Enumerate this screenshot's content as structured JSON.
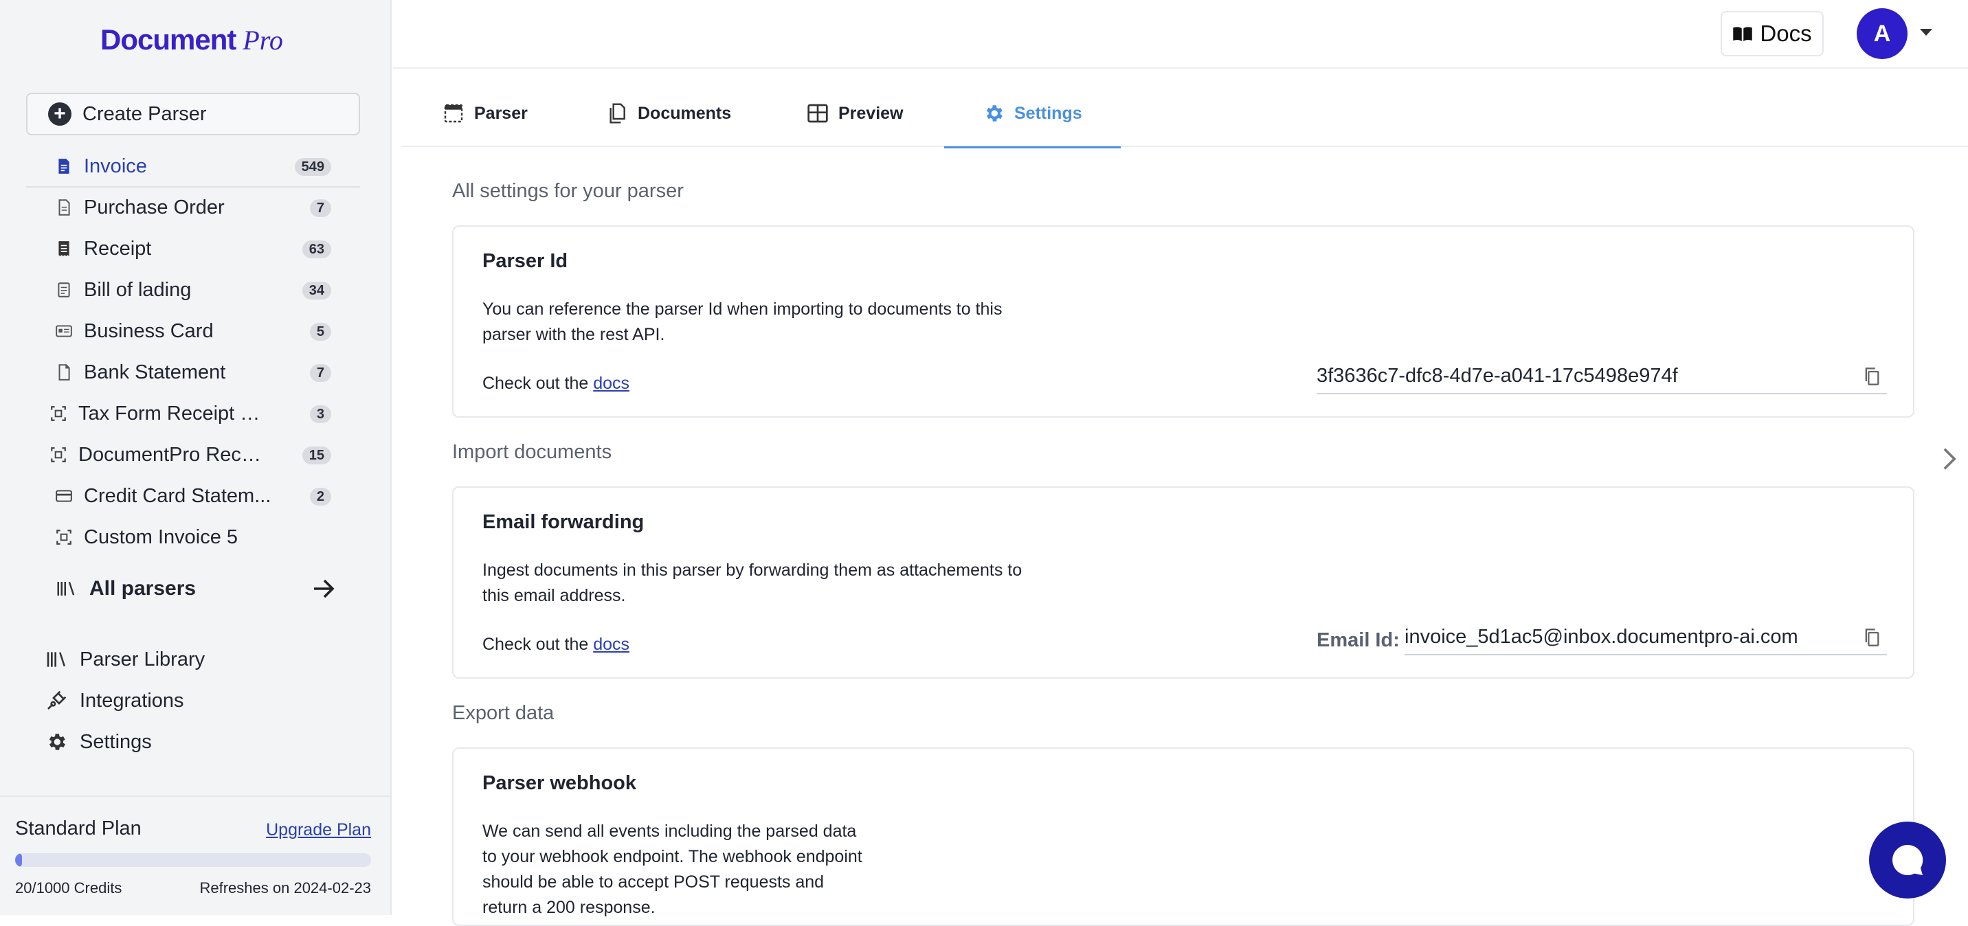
{
  "logo": {
    "part1": "Document",
    "part2": "Pro"
  },
  "sidebar": {
    "create_label": "Create Parser",
    "items": [
      {
        "label": "Invoice",
        "count": "549",
        "icon": "invoice-doc-icon",
        "active": true
      },
      {
        "label": "Purchase Order",
        "count": "7",
        "icon": "file-icon"
      },
      {
        "label": "Receipt",
        "count": "63",
        "icon": "receipt-icon"
      },
      {
        "label": "Bill of lading",
        "count": "34",
        "icon": "document-lines-icon"
      },
      {
        "label": "Business Card",
        "count": "5",
        "icon": "id-card-icon"
      },
      {
        "label": "Bank Statement",
        "count": "7",
        "icon": "file-outline-icon"
      },
      {
        "label": "Tax Form Receipt C...",
        "count": "3",
        "icon": "custom-frame-icon"
      },
      {
        "label": "DocumentPro Recei...",
        "count": "15",
        "icon": "custom-frame-icon"
      },
      {
        "label": "Credit Card Statem...",
        "count": "2",
        "icon": "credit-card-icon"
      },
      {
        "label": "Custom Invoice 5",
        "count": "",
        "icon": "custom-frame-icon"
      }
    ],
    "all_parsers_label": "All parsers",
    "secondary": [
      {
        "label": "Parser Library",
        "icon": "library-icon"
      },
      {
        "label": "Integrations",
        "icon": "plug-icon"
      },
      {
        "label": "Settings",
        "icon": "gear-icon"
      }
    ],
    "plan": {
      "title": "Standard Plan",
      "upgrade_label": "Upgrade Plan",
      "credits": "20/1000 Credits",
      "credits_fraction": 0.02,
      "refresh": "Refreshes on 2024-02-23"
    }
  },
  "topbar": {
    "docs_label": "Docs",
    "avatar_letter": "A"
  },
  "tabs": [
    {
      "label": "Parser",
      "icon": "parser-tab-icon"
    },
    {
      "label": "Documents",
      "icon": "documents-tab-icon"
    },
    {
      "label": "Preview",
      "icon": "preview-grid-icon"
    },
    {
      "label": "Settings",
      "icon": "gear-icon",
      "active": true
    }
  ],
  "main": {
    "settings_heading": "All settings for your parser",
    "parser_id": {
      "title": "Parser Id",
      "desc_line1": "You can reference the parser Id when importing to documents to this",
      "desc_line2": "parser with the rest API.",
      "checkout": "Check out the",
      "docs_link": "docs",
      "value": "3f3636c7-dfc8-4d7e-a041-17c5498e974f"
    },
    "import_heading": "Import documents",
    "email": {
      "title": "Email forwarding",
      "desc_line1": "Ingest documents in this parser by forwarding them as attachements to",
      "desc_line2": "this email address.",
      "checkout": "Check out the",
      "docs_link": "docs",
      "field_label": "Email Id:",
      "value": "invoice_5d1ac5@inbox.documentpro-ai.com"
    },
    "export_heading": "Export data",
    "webhook": {
      "title": "Parser webhook",
      "desc_line1": "We can send all events including the parsed data",
      "desc_line2": "to your webhook endpoint. The webhook endpoint",
      "desc_line3": "should be able to accept POST requests and",
      "desc_line4": "return a 200 response."
    }
  },
  "colors": {
    "brand": "#3b1fc9",
    "accent": "#4a90e2",
    "avatar": "#2d1ec9",
    "chat": "#1b1aa3"
  }
}
